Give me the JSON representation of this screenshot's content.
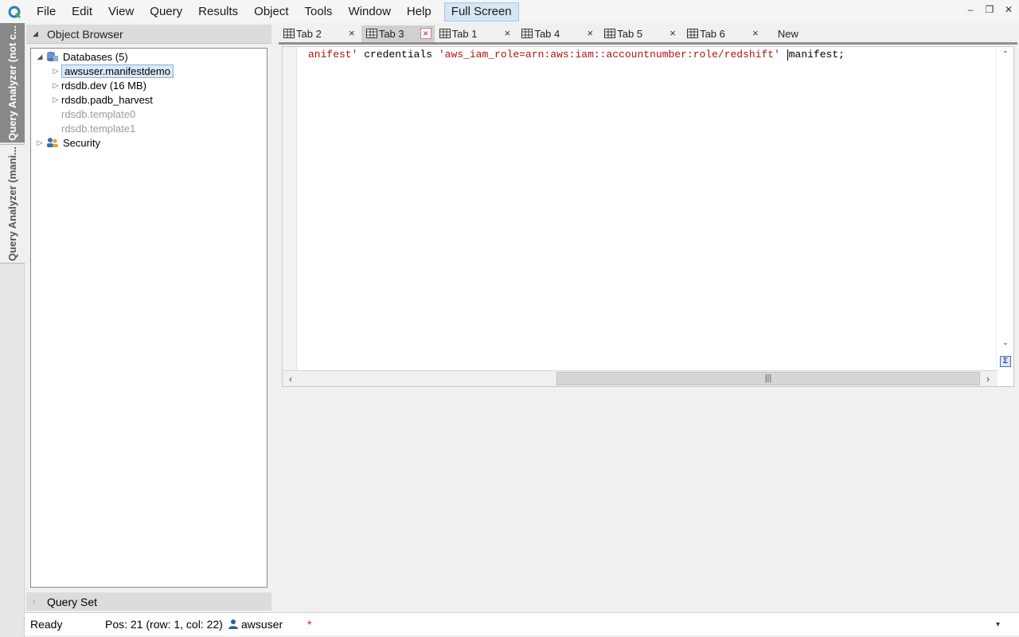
{
  "menu": {
    "items": [
      "File",
      "Edit",
      "View",
      "Query",
      "Results",
      "Object",
      "Tools",
      "Window",
      "Help"
    ],
    "fullscreen_label": "Full Screen"
  },
  "window_controls": {
    "minimize": "–",
    "restore": "❐",
    "close": "✕"
  },
  "left_strip": {
    "tab1": "Query Analyzer (not c...",
    "tab2": "Query Analyzer (mani..."
  },
  "object_browser": {
    "title": "Object Browser",
    "databases": {
      "label": "Databases (5)"
    },
    "items": [
      {
        "label": "awsuser.manifestdemo"
      },
      {
        "label": "rdsdb.dev (16 MB)"
      },
      {
        "label": "rdsdb.padb_harvest"
      },
      {
        "label": "rdsdb.template0"
      },
      {
        "label": "rdsdb.template1"
      }
    ],
    "security": {
      "label": "Security"
    }
  },
  "query_set": {
    "title": "Query Set"
  },
  "tabs": [
    {
      "label": "Tab 2"
    },
    {
      "label": "Tab 3"
    },
    {
      "label": "Tab 1"
    },
    {
      "label": "Tab 4"
    },
    {
      "label": "Tab 5"
    },
    {
      "label": "Tab 6"
    }
  ],
  "new_tab_label": "New",
  "tab_close": "×",
  "editor": {
    "code_part1": "anifest'",
    "code_part2": " credentials ",
    "code_part3": "'aws_iam_role=arn:aws:iam::accountnumber:role/redshift'",
    "code_part4": " ",
    "code_part5": "manifest;"
  },
  "statusbar": {
    "ready": "Ready",
    "position": "Pos: 21 (row: 1, col: 22)",
    "user": "awsuser",
    "modified": "*"
  },
  "colors": {
    "accent": "#d7e6f5",
    "string": "#b01010",
    "selected_tree": "#dbe9f7"
  }
}
